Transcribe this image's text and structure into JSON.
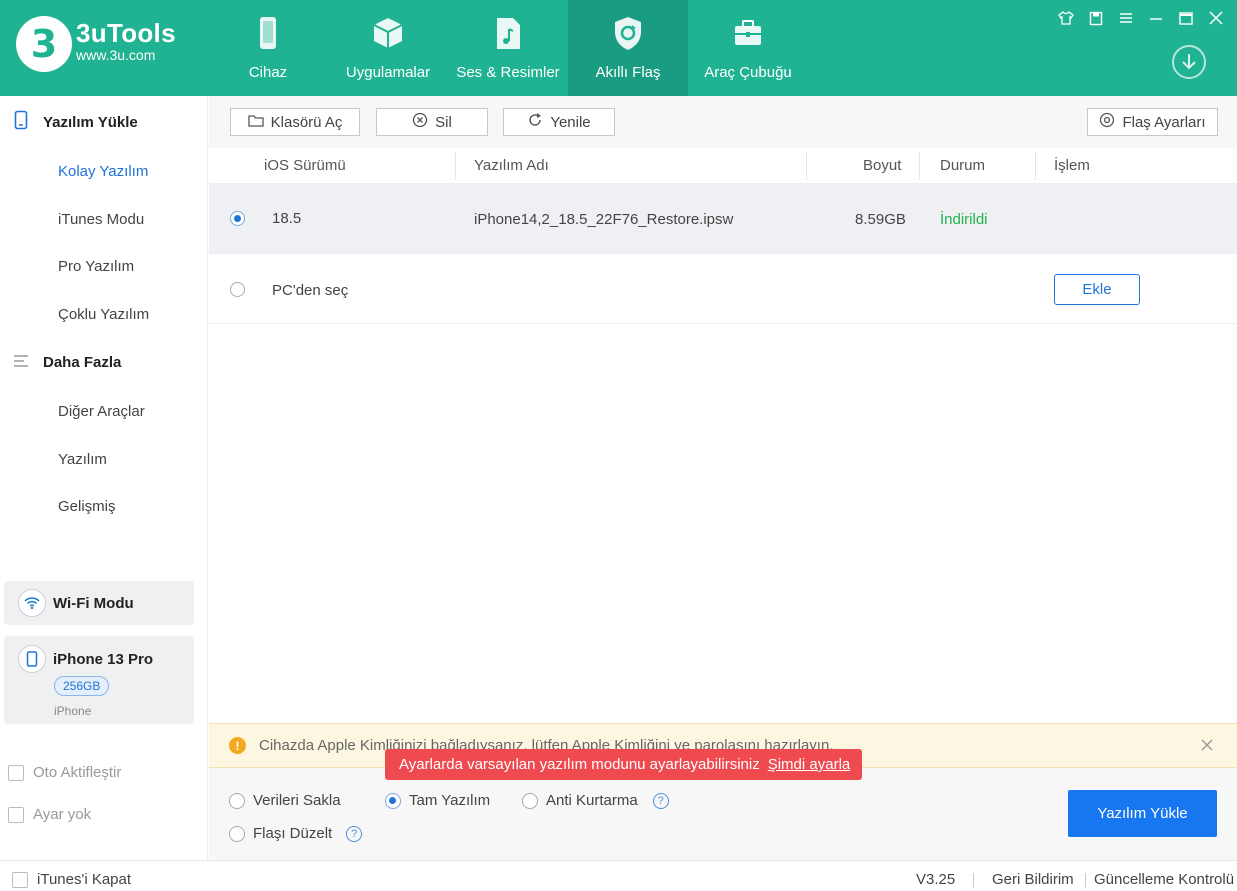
{
  "app": {
    "name": "3uTools",
    "url": "www.3u.com",
    "logo_char": "3"
  },
  "nav": {
    "items": [
      {
        "label": "Cihaz",
        "icon": "phone-icon"
      },
      {
        "label": "Uygulamalar",
        "icon": "cube-icon"
      },
      {
        "label": "Ses & Resimler",
        "icon": "music-file-icon"
      },
      {
        "label": "Akıllı Flaş",
        "icon": "refresh-shield-icon",
        "active": true
      },
      {
        "label": "Araç Çubuğu",
        "icon": "toolbox-icon"
      }
    ]
  },
  "window_controls": [
    "shirt-icon",
    "note-icon",
    "menu-icon",
    "minimize-icon",
    "maximize-icon",
    "close-icon"
  ],
  "sidebar": {
    "section1": "Yazılım Yükle",
    "section1_items": [
      "Kolay Yazılım",
      "iTunes Modu",
      "Pro Yazılım",
      "Çoklu Yazılım"
    ],
    "section2": "Daha Fazla",
    "section2_items": [
      "Diğer Araçlar",
      "Yazılım",
      "Gelişmiş"
    ],
    "wifi_label": "Wi-Fi Modu",
    "device": {
      "name": "iPhone 13 Pro",
      "capacity": "256GB",
      "type": "iPhone"
    },
    "auto_activate": "Oto Aktifleştir",
    "no_settings": "Ayar yok",
    "itunes_close": "iTunes'i Kapat"
  },
  "toolbar": {
    "open_folder": "Klasörü Aç",
    "delete": "Sil",
    "refresh": "Yenile",
    "flash_settings": "Flaş Ayarları"
  },
  "table": {
    "headers": {
      "ios": "iOS Sürümü",
      "name": "Yazılım Adı",
      "size": "Boyut",
      "status": "Durum",
      "action": "İşlem"
    },
    "rows": [
      {
        "version": "18.5",
        "filename": "iPhone14,2_18.5_22F76_Restore.ipsw",
        "size": "8.59GB",
        "status": "İndirildi"
      }
    ],
    "pc_select": "PC'den seç",
    "add_button": "Ekle"
  },
  "warning": {
    "text": "Cihazda Apple Kimliğinizi bağladıysanız, lütfen Apple Kimliğini ve parolasını hazırlayın."
  },
  "tooltip": {
    "text": "Ayarlarda varsayılan yazılım modunu ayarlayabilirsiniz",
    "link": "Şimdi ayarla"
  },
  "options": {
    "keep_data": "Verileri Sakla",
    "full_firmware": "Tam Yazılım",
    "anti_recovery": "Anti Kurtarma",
    "fix_flash": "Flaşı Düzelt",
    "help_char": "?",
    "flash_button": "Yazılım Yükle"
  },
  "status_bar": {
    "version": "V3.25",
    "feedback": "Geri Bildirim",
    "update_check": "Güncelleme Kontrolü"
  },
  "colors": {
    "header": "#1fb293",
    "accent": "#1e74d8",
    "success": "#22b14c",
    "tooltip": "#ef4a4f",
    "primary_button": "#1677f0"
  }
}
